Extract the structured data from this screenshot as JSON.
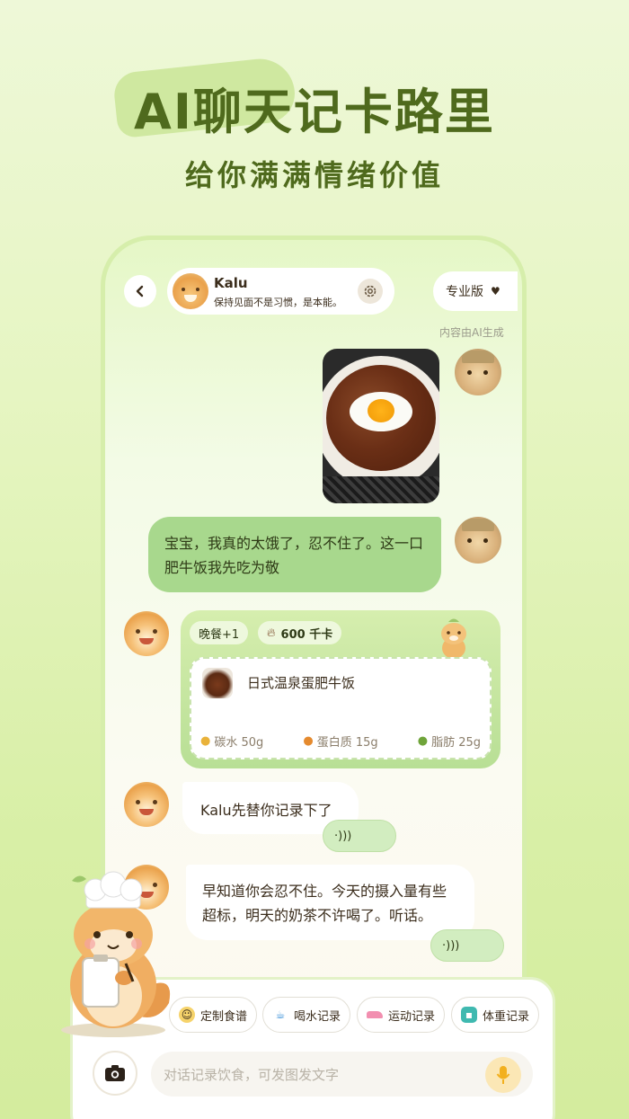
{
  "hero": {
    "title": "AI聊天记卡路里",
    "subtitle": "给你满满情绪价值"
  },
  "header": {
    "back_icon": "chevron-left-icon",
    "bot_name": "Kalu",
    "bot_motto": "保持见面不是习惯，是本能。",
    "settings_icon": "gear-icon",
    "plan_label": "专业版",
    "plan_icon": "heart-icon"
  },
  "ai_note": "内容由AI生成",
  "messages": {
    "user_text": "宝宝，我真的太饿了，忍不住了。这一口肥牛饭我先吃为敬",
    "meal": {
      "meal_tag": "晚餐+1",
      "calories": "600 千卡",
      "fire_icon": "flame-icon",
      "dish_name": "日式温泉蛋肥牛饭",
      "carbs": "碳水 50g",
      "protein": "蛋白质 15g",
      "fat": "脂肪 25g"
    },
    "bot_reply_1": "Kalu先替你记录下了",
    "bot_reply_2": "早知道你会忍不住。今天的摄入量有些超标，明天的奶茶不许喝了。听话。",
    "voice_icon": "sound-wave-icon"
  },
  "quick_actions": [
    {
      "label": "定制食谱",
      "icon": "recipe-icon"
    },
    {
      "label": "喝水记录",
      "icon": "water-cup-icon"
    },
    {
      "label": "运动记录",
      "icon": "sneaker-icon"
    },
    {
      "label": "体重记录",
      "icon": "scale-icon"
    }
  ],
  "composer": {
    "camera_icon": "camera-icon",
    "placeholder": "对话记录饮食，可发图发文字",
    "mic_icon": "microphone-icon"
  },
  "colors": {
    "brand_green": "#4f6a1d",
    "bubble_green": "#a8d88d",
    "accent_orange": "#f19a07"
  }
}
